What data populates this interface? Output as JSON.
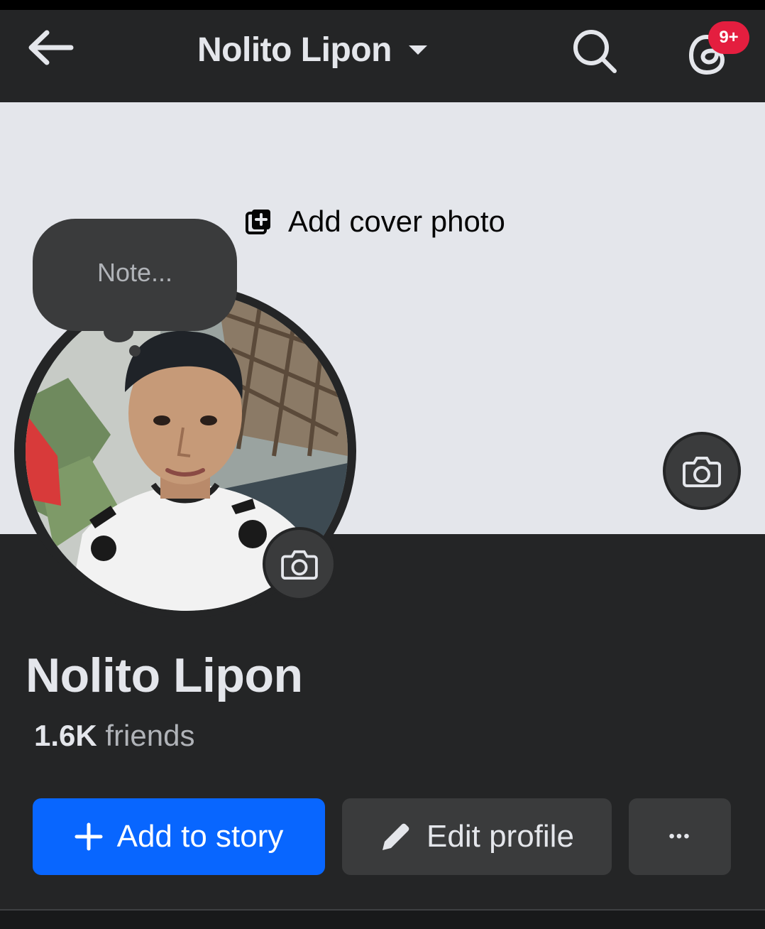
{
  "header": {
    "title": "Nolito Lipon",
    "notification_badge": "9+"
  },
  "cover": {
    "add_cover_label": "Add cover photo"
  },
  "note": {
    "placeholder": "Note..."
  },
  "profile": {
    "name": "Nolito Lipon",
    "friends_count": "1.6K",
    "friends_label": " friends"
  },
  "actions": {
    "add_story_label": "Add to story",
    "edit_profile_label": "Edit profile",
    "more_label": "•••"
  },
  "colors": {
    "primary": "#0866ff",
    "background": "#242526",
    "cover": "#e4e6eb",
    "badge": "#e41e3f"
  },
  "icons": [
    "back-arrow-icon",
    "caret-down-icon",
    "search-icon",
    "threads-icon",
    "add-photo-icon",
    "camera-icon",
    "plus-icon",
    "pencil-icon",
    "more-icon"
  ]
}
